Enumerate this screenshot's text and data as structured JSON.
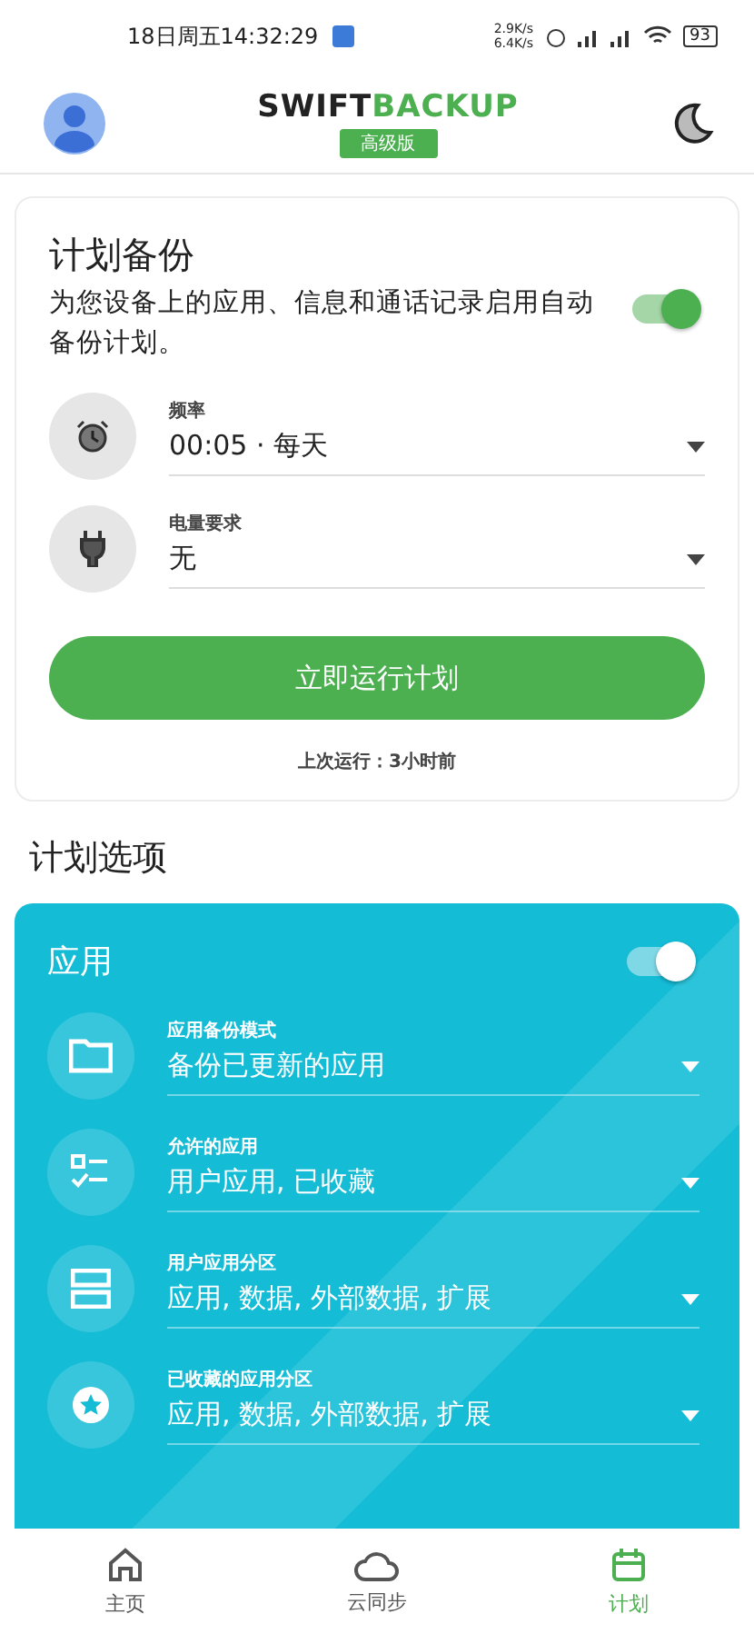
{
  "status_bar": {
    "time": "18日周五14:32:29",
    "speed_up": "2.9K/s",
    "speed_down": "6.4K/s",
    "battery": "93"
  },
  "header": {
    "logo_left": "SWIFT",
    "logo_right": "BACKUP",
    "badge": "高级版"
  },
  "schedule_card": {
    "title": "计划备份",
    "description": "为您设备上的应用、信息和通话记录启用自动备份计划。",
    "enabled": true,
    "fields": [
      {
        "kind": "alarm",
        "label": "频率",
        "value": "00:05 · 每天"
      },
      {
        "kind": "plug",
        "label": "电量要求",
        "value": "无"
      }
    ],
    "run_button": "立即运行计划",
    "last_run": "上次运行：3小时前"
  },
  "options_title": "计划选项",
  "apps_card": {
    "title": "应用",
    "enabled": true,
    "fields": [
      {
        "kind": "folder",
        "label": "应用备份模式",
        "value": "备份已更新的应用"
      },
      {
        "kind": "checklist",
        "label": "允许的应用",
        "value": "用户应用, 已收藏"
      },
      {
        "kind": "storage",
        "label": "用户应用分区",
        "value": "应用, 数据, 外部数据, 扩展"
      },
      {
        "kind": "star",
        "label": "已收藏的应用分区",
        "value": "应用, 数据, 外部数据, 扩展"
      }
    ]
  },
  "bottom_nav": [
    {
      "kind": "home",
      "label": "主页",
      "selected": false
    },
    {
      "kind": "cloud",
      "label": "云同步",
      "selected": false
    },
    {
      "kind": "schedule",
      "label": "计划",
      "selected": true
    }
  ]
}
